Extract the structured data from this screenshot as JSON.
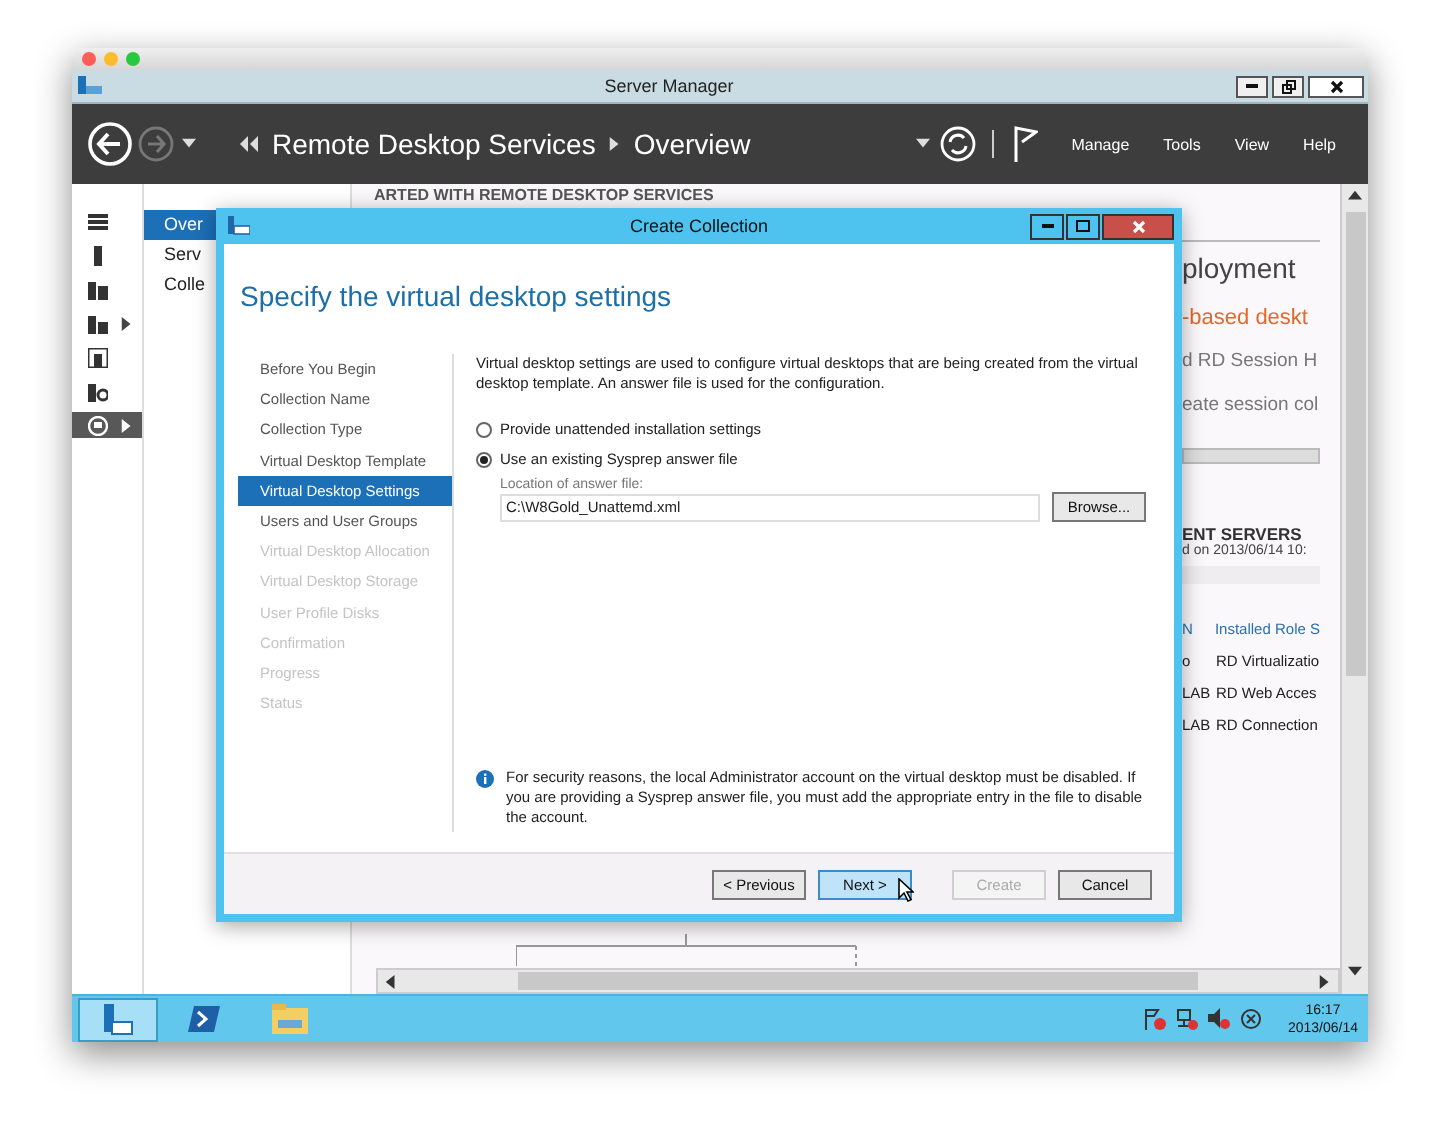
{
  "window": {
    "title": "Server Manager"
  },
  "toolbar": {
    "breadcrumb": [
      "Remote Desktop Services",
      "Overview"
    ],
    "menu": [
      "Manage",
      "Tools",
      "View",
      "Help"
    ]
  },
  "rail": [
    {
      "selected": false,
      "expandable": false
    },
    {
      "selected": false,
      "expandable": false
    },
    {
      "selected": false,
      "expandable": false
    },
    {
      "selected": false,
      "expandable": true
    },
    {
      "selected": false,
      "expandable": false
    },
    {
      "selected": false,
      "expandable": false
    },
    {
      "selected": true,
      "expandable": true
    }
  ],
  "nav": [
    {
      "label": "Over",
      "selected": true
    },
    {
      "label": "Serv",
      "selected": false
    },
    {
      "label": "Colle",
      "selected": false
    }
  ],
  "overview": {
    "section_heading": "ARTED WITH REMOTE DESKTOP SERVICES",
    "deployment_heading": "ployment",
    "lines": [
      {
        "text": "-based deskt",
        "kind": "accent"
      },
      {
        "text": "d RD Session H",
        "kind": "plain"
      },
      {
        "text": "eate session col",
        "kind": "plain"
      }
    ],
    "servers_title": "ENT SERVERS",
    "servers_subtitle": "d on 2013/06/14 10:",
    "columns": [
      "N",
      "Installed Role S"
    ],
    "rows": [
      [
        "o",
        "RD Virtualizatio"
      ],
      [
        "LAB",
        "RD Web Acces"
      ],
      [
        "LAB",
        "RD Connection"
      ]
    ]
  },
  "dialog": {
    "title": "Create Collection",
    "heading": "Specify the virtual desktop settings",
    "steps": [
      {
        "label": "Before You Begin",
        "selected": false,
        "disabled": false
      },
      {
        "label": "Collection Name",
        "selected": false,
        "disabled": false
      },
      {
        "label": "Collection Type",
        "selected": false,
        "disabled": false
      },
      {
        "label": "Virtual Desktop Template",
        "selected": false,
        "disabled": false
      },
      {
        "label": "Virtual Desktop Settings",
        "selected": true,
        "disabled": false
      },
      {
        "label": "Users and User Groups",
        "selected": false,
        "disabled": false
      },
      {
        "label": "Virtual Desktop Allocation",
        "selected": false,
        "disabled": true
      },
      {
        "label": "Virtual Desktop Storage",
        "selected": false,
        "disabled": true
      },
      {
        "label": "User Profile Disks",
        "selected": false,
        "disabled": true
      },
      {
        "label": "Confirmation",
        "selected": false,
        "disabled": true
      },
      {
        "label": "Progress",
        "selected": false,
        "disabled": true
      },
      {
        "label": "Status",
        "selected": false,
        "disabled": true
      }
    ],
    "description": "Virtual desktop settings are used to configure virtual desktops that are being created from the virtual desktop template. An answer file is used for the configuration.",
    "options": [
      {
        "label": "Provide unattended installation settings",
        "selected": false
      },
      {
        "label": "Use an existing Sysprep answer file",
        "selected": true
      }
    ],
    "answer_file_label": "Location of answer file:",
    "answer_file_value": "C:\\W8Gold_Unattemd.xml",
    "browse": "Browse...",
    "note": "For security reasons, the local Administrator account on the virtual desktop must be disabled. If you are providing a Sysprep answer file, you must add the appropriate entry in the file to disable the account.",
    "buttons": [
      {
        "label": "< Previous",
        "default": false,
        "disabled": false
      },
      {
        "label": "Next >",
        "default": true,
        "disabled": false
      },
      {
        "label": "Create",
        "default": false,
        "disabled": true
      },
      {
        "label": "Cancel",
        "default": false,
        "disabled": false
      }
    ]
  },
  "taskbar": {
    "apps": [
      {
        "selected": true
      },
      {
        "selected": false
      },
      {
        "selected": false
      }
    ],
    "time": "16:17",
    "date": "2013/06/14"
  }
}
